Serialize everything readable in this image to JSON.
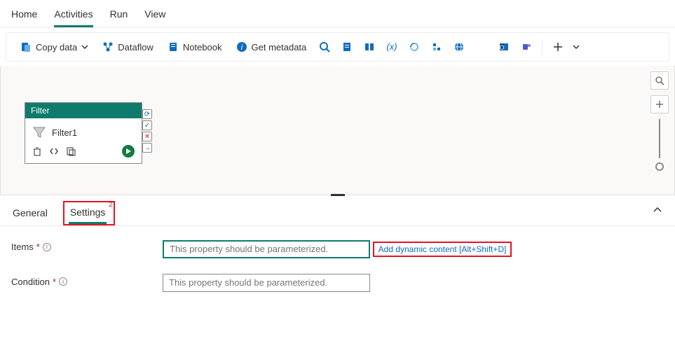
{
  "topTabs": {
    "home": "Home",
    "activities": "Activities",
    "run": "Run",
    "view": "View"
  },
  "toolbar": {
    "copyData": "Copy data",
    "dataflow": "Dataflow",
    "notebook": "Notebook",
    "getMetadata": "Get metadata"
  },
  "node": {
    "type": "Filter",
    "name": "Filter1"
  },
  "panelTabs": {
    "general": "General",
    "settings": "Settings",
    "settingsBadge": "2"
  },
  "form": {
    "itemsLabel": "Items",
    "itemsPlaceholder": "This property should be parameterized.",
    "addDynamic": "Add dynamic content [Alt+Shift+D]",
    "conditionLabel": "Condition",
    "conditionPlaceholder": "This property should be parameterized."
  },
  "colors": {
    "accent": "#0f7b6c",
    "link": "#0f6cbd",
    "error": "#e81123"
  }
}
